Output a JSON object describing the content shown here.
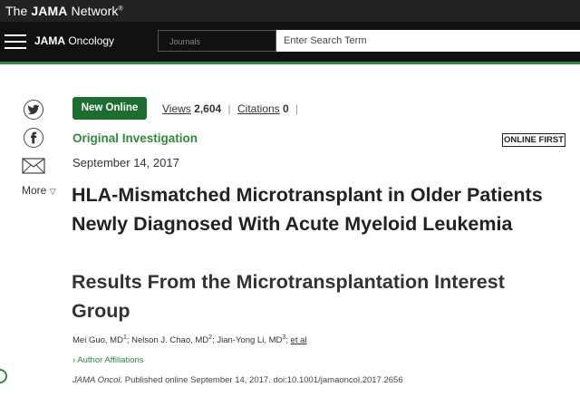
{
  "network": {
    "prefix": "The ",
    "brand_bold": "JAMA",
    "brand_rest": " Network",
    "trademark": "®"
  },
  "journal": {
    "bold": "JAMA",
    "rest": " Oncology"
  },
  "search": {
    "scope_label": "Journals",
    "placeholder": "Enter Search Term"
  },
  "share": {
    "more_label": "More",
    "more_chevron": "▽"
  },
  "article": {
    "badge": "New Online",
    "views_label": "Views",
    "views_count": "2,604",
    "citations_label": "Citations",
    "citations_count": "0",
    "separator": "|",
    "category": "Original Investigation",
    "online_first": "ONLINE FIRST",
    "date": "September 14, 2017",
    "title": "HLA-Mismatched Microtransplant in Older Patients Newly Diagnosed With Acute Myeloid Leukemia",
    "subtitle": "Results From the Microtransplantation Interest Group",
    "authors": [
      {
        "name": "Mei Guo, MD",
        "sup": "1"
      },
      {
        "name": "Nelson J. Chao, MD",
        "sup": "2"
      },
      {
        "name": "Jian-Yong Li, MD",
        "sup": "3"
      }
    ],
    "et_al": "et al",
    "affiliations_toggle": "Author Affiliations",
    "citation_journal": "JAMA Oncol.",
    "citation_rest": " Published online September 14, 2017. doi:10.1001/jamaoncol.2017.2656"
  },
  "colors": {
    "brand_green": "#2e8b3c",
    "badge_green": "#1b6e2e",
    "header_black": "#111111",
    "network_bar": "#222222"
  }
}
